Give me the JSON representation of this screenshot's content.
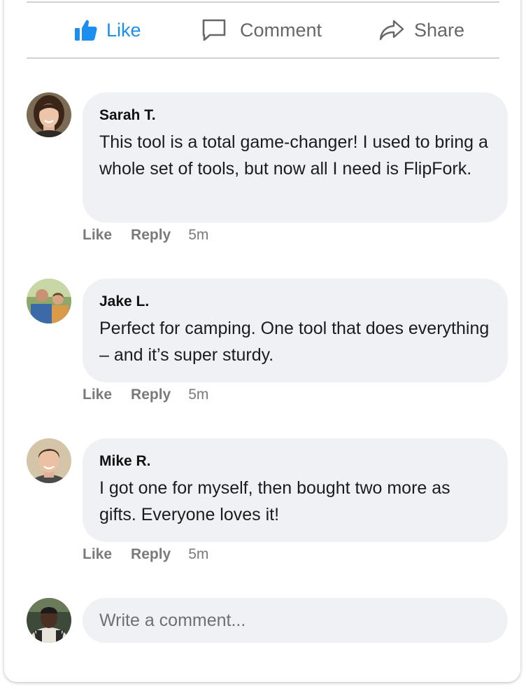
{
  "actions": {
    "like_label": "Like",
    "comment_label": "Comment",
    "share_label": "Share"
  },
  "colors": {
    "like_accent": "#1b8ff0",
    "bubble_bg": "#f0f1f5",
    "muted_text": "#65676b"
  },
  "comments": [
    {
      "author": "Sarah T.",
      "text": "This tool is a total game-changer! I used to bring a whole set of tools, but now all I need is FlipFork.",
      "like_label": "Like",
      "reply_label": "Reply",
      "time": "5m"
    },
    {
      "author": "Jake L.",
      "text": "Perfect for camping. One tool that does everything – and it’s super sturdy.",
      "like_label": "Like",
      "reply_label": "Reply",
      "time": "5m"
    },
    {
      "author": "Mike R.",
      "text": "I got one for myself, then bought two more as gifts. Everyone loves it!",
      "like_label": "Like",
      "reply_label": "Reply",
      "time": "5m"
    }
  ],
  "composer": {
    "placeholder": "Write a comment..."
  }
}
